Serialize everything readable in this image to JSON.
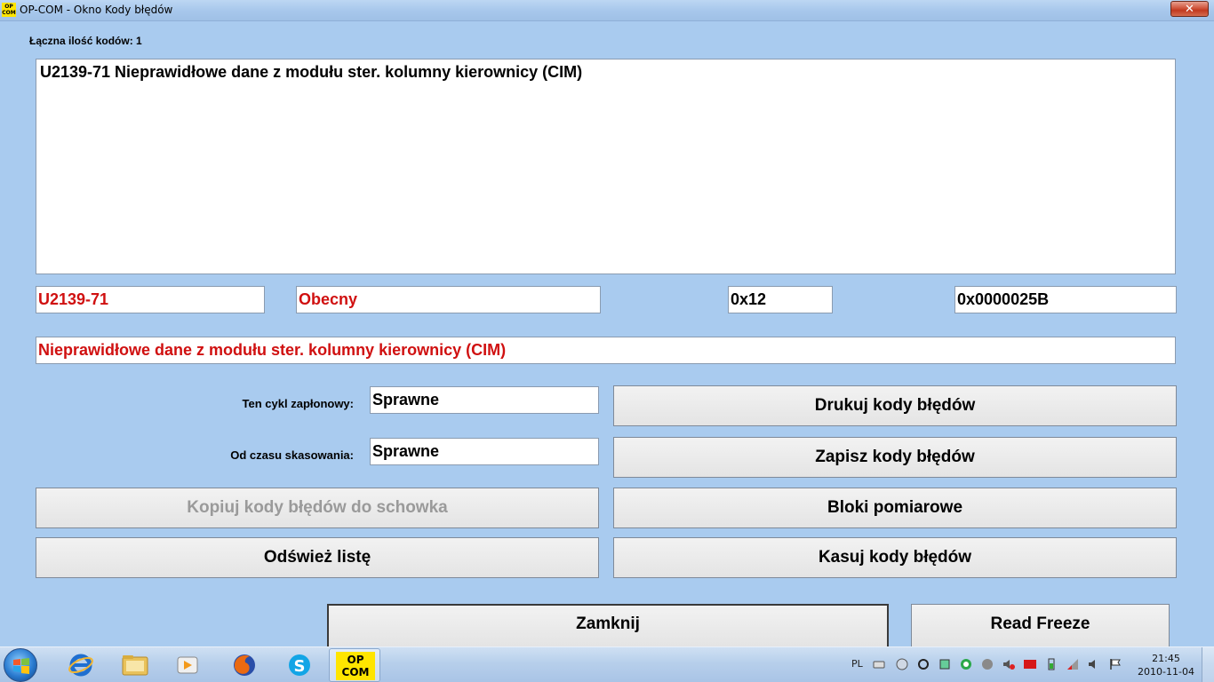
{
  "window": {
    "app_icon_text": "OP COM",
    "title": "OP-COM - Okno Kody błędów",
    "close_symbol": "✕"
  },
  "summary": {
    "total_label": "Łączna ilość kodów: 1"
  },
  "code_list": {
    "items": [
      "U2139-71 Nieprawidłowe dane z modułu ster. kolumny kierownicy (CIM)"
    ]
  },
  "details": {
    "code": "U2139-71",
    "status": "Obecny",
    "hex_short": "0x12",
    "hex_long": "0x0000025B",
    "description": "Nieprawidłowe dane z modułu ster. kolumny kierownicy (CIM)"
  },
  "ignition": {
    "cycle_label": "Ten cykl zapłonowy:",
    "cycle_value": "Sprawne",
    "since_clear_label": "Od czasu skasowania:",
    "since_clear_value": "Sprawne"
  },
  "buttons": {
    "print": "Drukuj kody błędów",
    "save": "Zapisz kody błędów",
    "copy": "Kopiuj kody błędów do schowka",
    "blocks": "Bloki pomiarowe",
    "refresh": "Odśwież listę",
    "clear": "Kasuj kody błędów",
    "close": "Zamknij",
    "freeze": "Read Freeze"
  },
  "taskbar": {
    "opcom_label": "OP COM",
    "language": "PL",
    "time": "21:45",
    "date": "2010-11-04"
  },
  "colors": {
    "background": "#a9cbef",
    "error_text": "#d01010"
  }
}
